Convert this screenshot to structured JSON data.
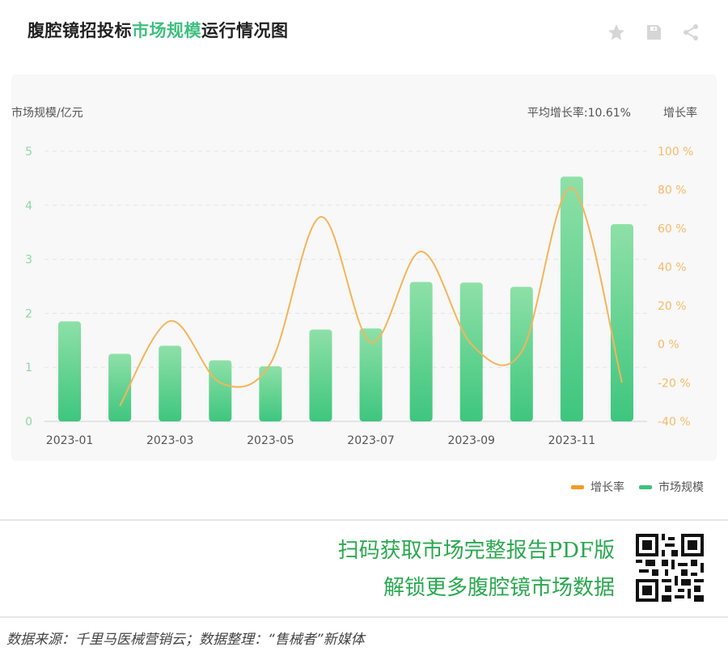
{
  "title": {
    "prefix": "腹腔镜招投标",
    "highlight": "市场规模",
    "suffix": "运行情况图"
  },
  "actions": [
    {
      "icon": "star-icon"
    },
    {
      "icon": "save-icon"
    },
    {
      "icon": "share-icon"
    }
  ],
  "colors": {
    "bar_top": "#8ee0a7",
    "bar_bottom": "#3ec67e",
    "line": "#f5b45a",
    "legend_line": "#f59b23",
    "legend_bar": "#3fc17d",
    "promo": "#2aa84f"
  },
  "chart_data": {
    "type": "bar",
    "left_axis_label": "市场规模/亿元",
    "right_axis_label": "增长率",
    "avg_growth_label": "平均增长率:10.61%",
    "x": [
      "2023-01",
      "2023-02",
      "2023-03",
      "2023-04",
      "2023-05",
      "2023-06",
      "2023-07",
      "2023-08",
      "2023-09",
      "2023-10",
      "2023-11",
      "2023-12"
    ],
    "x_tick_labels": [
      "2023-01",
      "2023-03",
      "2023-05",
      "2023-07",
      "2023-09",
      "2023-11"
    ],
    "series": [
      {
        "name": "市场规模",
        "type": "bar",
        "axis": "left",
        "values": [
          1.85,
          1.25,
          1.4,
          1.13,
          1.02,
          1.7,
          1.72,
          2.58,
          2.57,
          2.49,
          4.53,
          3.65
        ]
      },
      {
        "name": "增长率",
        "type": "line",
        "axis": "right",
        "values": [
          null,
          -32,
          12,
          -20,
          -10,
          66,
          1,
          48,
          0,
          -4,
          81,
          -20
        ]
      }
    ],
    "left_ylim": [
      0,
      5
    ],
    "left_ticks": [
      "0",
      "1",
      "2",
      "3",
      "4",
      "5"
    ],
    "right_ylim": [
      -40,
      100
    ],
    "right_ticks": [
      "-40 %",
      "-20 %",
      "0 %",
      "20 %",
      "40 %",
      "60 %",
      "80 %",
      "100 %"
    ],
    "grid": true,
    "legend_position": "bottom-right"
  },
  "promo": {
    "line1": "扫码获取市场完整报告PDF版",
    "line2": "解锁更多腹腔镜市场数据"
  },
  "footer": "数据来源：千里马医械营销云；数据整理：“售械者”新媒体"
}
